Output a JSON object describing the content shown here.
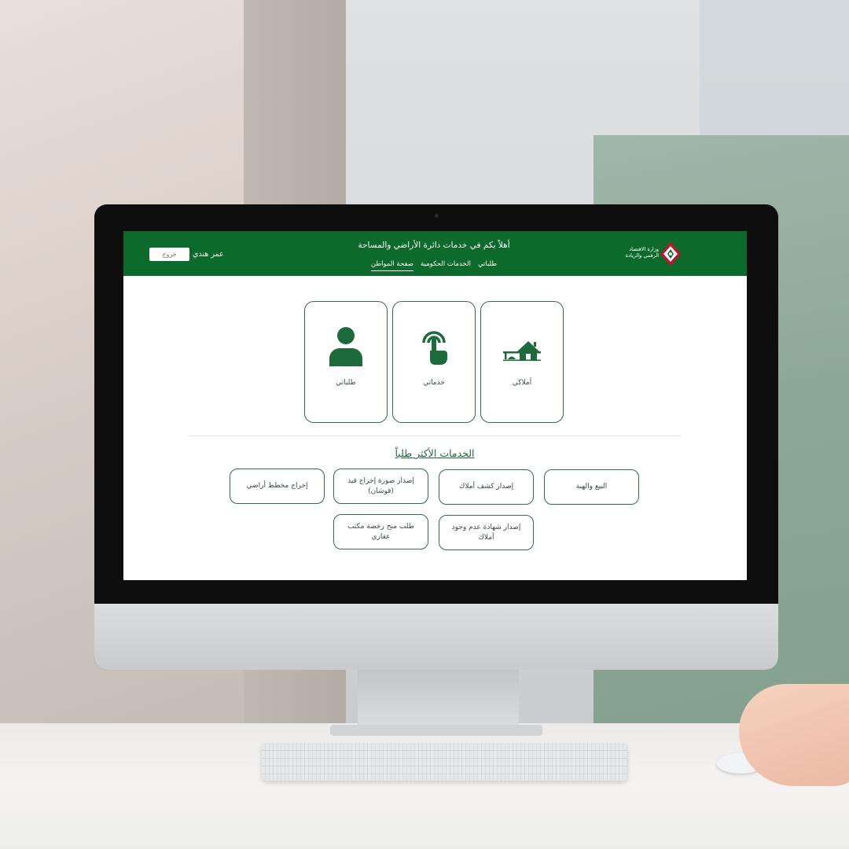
{
  "header": {
    "logo_text": "وزارة الاقتصاد الرقمي والريادة",
    "welcome": "أهلاً بكم في خدمات دائرة الأراضي والمساحة",
    "nav": [
      {
        "label": "صفحة المواطن",
        "active": true
      },
      {
        "label": "الخدمات الحكومية",
        "active": false
      },
      {
        "label": "طلباتي",
        "active": false
      }
    ],
    "username": "عمر هندي",
    "logout_label": "خروج"
  },
  "cards": [
    {
      "label": "أملاكي",
      "icon": "house-icon"
    },
    {
      "label": "خدماتي",
      "icon": "touch-hand-icon"
    },
    {
      "label": "طلباتي",
      "icon": "person-icon"
    }
  ],
  "popular": {
    "title": "الخدمات الأكثر طلباً",
    "services": [
      "البيع والهبة",
      "إصدار كشف أملاك",
      "إصدار صورة إخراج قيد (قوشان)",
      "إخراج مخطط أراضي",
      "إصدار شهادة عدم وجود أملاك",
      "طلب منح رخصة مكتب عقاري"
    ]
  },
  "colors": {
    "brand_green": "#0c6b2c",
    "icon_green": "#1d6b3a",
    "border_green": "#2f6e47"
  }
}
